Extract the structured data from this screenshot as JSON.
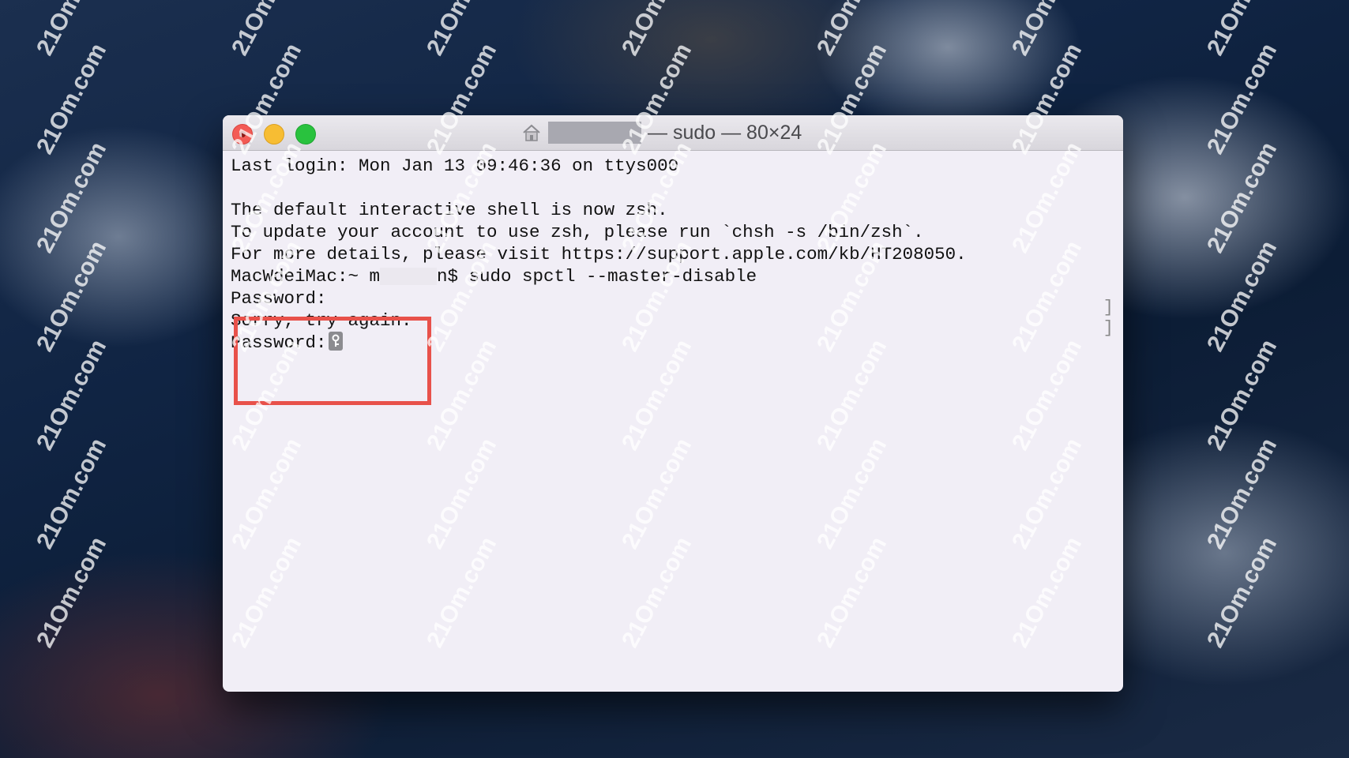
{
  "window": {
    "title": "— sudo — 80×24"
  },
  "terminal": {
    "lines": [
      "Last login: Mon Jan 13 09:46:36 on ttys000",
      "",
      "The default interactive shell is now zsh.",
      "To update your account to use zsh, please run `chsh -s /bin/zsh`.",
      "For more details, please visit https://support.apple.com/kb/HT208050."
    ],
    "prompt_prefix": "MacWdeiMac:~ m",
    "prompt_suffix": "n$ sudo spctl --master-disable",
    "password_label": "Password:",
    "sorry": "Sorry, try again.",
    "password_label_2": "Password:"
  },
  "watermark": "21Om.com",
  "colors": {
    "highlight": "#e8514a",
    "close": "#f35b55",
    "minimize": "#f7bd33",
    "maximize": "#29c23e"
  }
}
